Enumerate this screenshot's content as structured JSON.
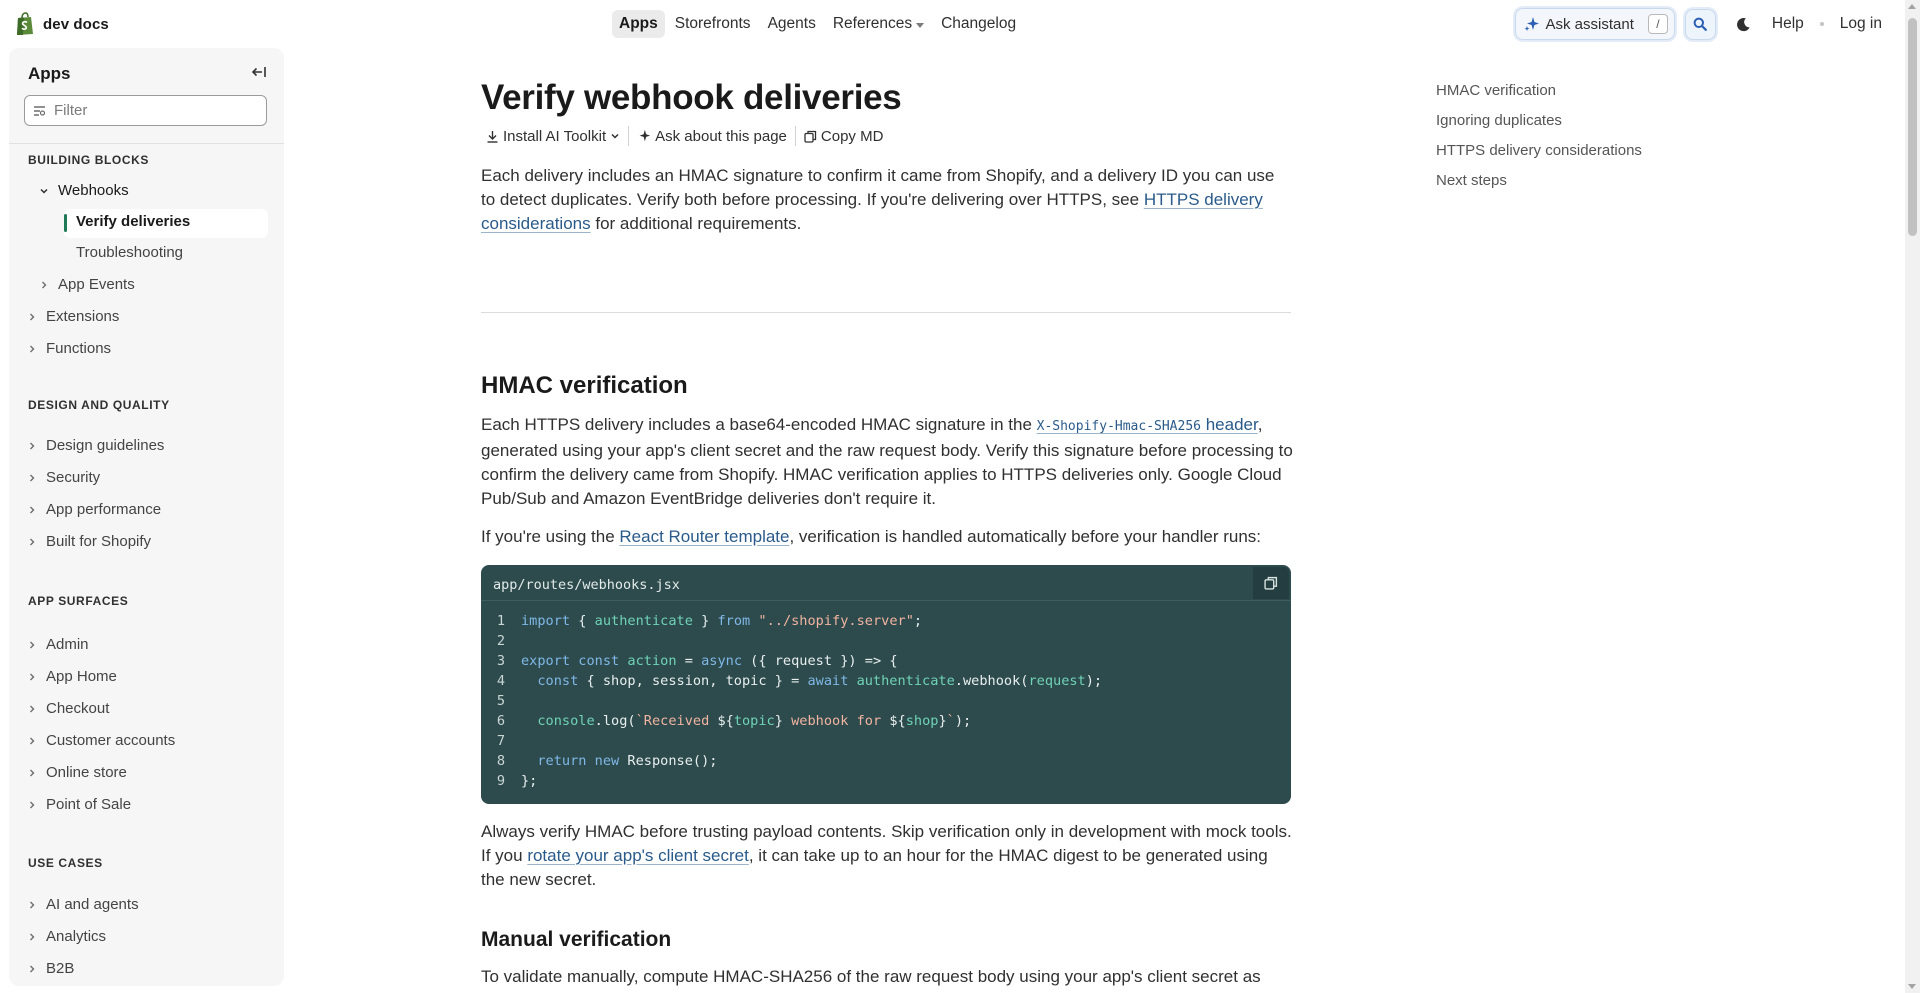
{
  "app": {
    "logo_text": "dev docs"
  },
  "topnav": {
    "items": [
      {
        "label": "Apps",
        "active": true
      },
      {
        "label": "Storefronts"
      },
      {
        "label": "Agents"
      },
      {
        "label": "References",
        "has_dropdown": true
      },
      {
        "label": "Changelog"
      }
    ]
  },
  "toolbar": {
    "ask_label": "Ask assistant",
    "ask_shortcut": "/",
    "help_label": "Help",
    "login_label": "Log in"
  },
  "sidebar": {
    "title": "Apps",
    "filter_placeholder": "Filter",
    "sections": [
      {
        "title": "BUILDING BLOCKS"
      },
      {
        "title": "DESIGN AND QUALITY"
      },
      {
        "title": "APP SURFACES"
      },
      {
        "title": "USE CASES"
      }
    ],
    "building_blocks": {
      "webhooks": "Webhooks",
      "verify": "Verify deliveries",
      "troubleshooting": "Troubleshooting",
      "app_events": "App Events",
      "extensions": "Extensions",
      "functions": "Functions"
    },
    "design_quality": [
      "Design guidelines",
      "Security",
      "App performance",
      "Built for Shopify"
    ],
    "app_surfaces": [
      "Admin",
      "App Home",
      "Checkout",
      "Customer accounts",
      "Online store",
      "Point of Sale"
    ],
    "use_cases": [
      "AI and agents",
      "Analytics",
      "B2B"
    ]
  },
  "page": {
    "title": "Verify webhook deliveries",
    "actions": {
      "install": "Install AI Toolkit",
      "ask": "Ask about this page",
      "copy": "Copy MD"
    },
    "intro": {
      "text1": "Each delivery includes an HMAC signature to confirm it came from Shopify, and a delivery ID you can use to detect duplicates. Verify both before processing. If you're delivering over HTTPS, see ",
      "link": "HTTPS delivery considerations",
      "text2": " for additional requirements."
    },
    "hmac": {
      "heading": "HMAC verification",
      "p1_a": "Each HTTPS delivery includes a base64-encoded HMAC signature in the ",
      "p1_code": "X-Shopify-Hmac-SHA256",
      "p1_link": " header",
      "p1_b": ", generated using your app's client secret and the raw request body. Verify this signature before processing to confirm the delivery came from Shopify. HMAC verification applies to HTTPS deliveries only. Google Cloud Pub/Sub and Amazon EventBridge deliveries don't require it.",
      "p2_a": "If you're using the ",
      "p2_link": "React Router template",
      "p2_b": ", verification is handled automatically before your handler runs:",
      "p3_a": "Always verify HMAC before trusting payload contents. Skip verification only in development with mock tools. If you ",
      "p3_link": "rotate your app's client secret",
      "p3_b": ", it can take up to an hour for the HMAC digest to be generated using the new secret."
    },
    "code": {
      "filename": "app/routes/webhooks.jsx",
      "line_numbers": [
        "1",
        "2",
        "3",
        "4",
        "5",
        "6",
        "7",
        "8",
        "9"
      ]
    },
    "manual": {
      "heading": "Manual verification",
      "text": "To validate manually, compute HMAC-SHA256 of the raw request body using your app's client secret as"
    }
  },
  "toc": {
    "items": [
      "HMAC verification",
      "Ignoring duplicates",
      "HTTPS delivery considerations",
      "Next steps"
    ]
  },
  "colors": {
    "accent": "#1f7a5a",
    "link": "#2a5a8a",
    "code_bg": "#2d4a4d",
    "sidebar_bg": "#f6f6f7"
  }
}
